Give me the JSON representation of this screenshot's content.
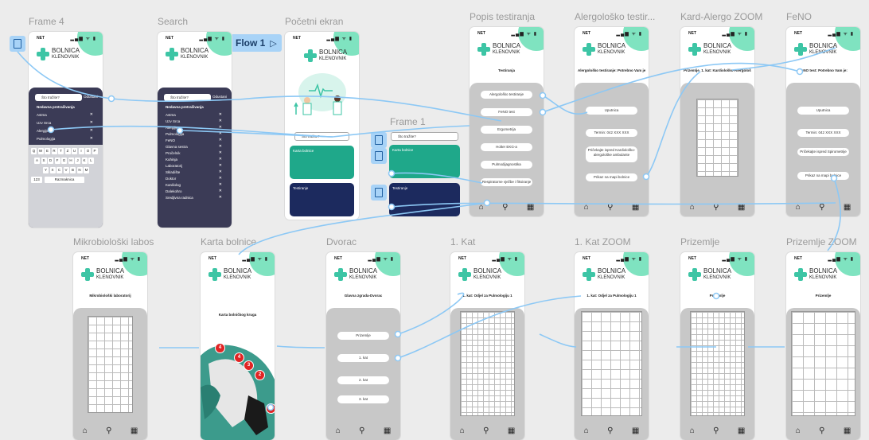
{
  "frame_labels": {
    "frame4": "Frame 4",
    "search": "Search",
    "home": "Početni ekran",
    "frame1": "Frame 1",
    "popis": "Popis testiranja",
    "alergo": "Alergološko testir...",
    "kard_zoom": "Kard-Alergo ZOOM",
    "feno": "FeNO",
    "mikro": "Mikrobiološki labos",
    "karta": "Karta bolnice",
    "dvorac": "Dvorac",
    "kat1": "1. Kat",
    "kat1_zoom": "1. Kat ZOOM",
    "prizemlje": "Prizemlje",
    "prizemlje_zoom": "Prizemlje ZOOM"
  },
  "flow_button": {
    "label": "Flow 1",
    "icon": "play-frame-icon"
  },
  "status": {
    "net": "NET",
    "signal": "▂▄▆ ᯤ ▮"
  },
  "brand": {
    "name": "BOLNICA",
    "sub": "KLENOVNIK",
    "color": "#3dc5a5",
    "accent": "#7fe3c0"
  },
  "search": {
    "placeholder": "Što tražite?",
    "cancel": "Odustani",
    "recent_title": "Nedavna pretraživanja",
    "frame4_items": [
      "Astma",
      "Uzv Srca",
      "Alergije",
      "Pulmologija",
      "FeNO",
      "Glavna sestra"
    ],
    "search_items": [
      "Astma",
      "Uzv Srca",
      "Alergije",
      "Pulmologija",
      "FeNO",
      "Glavna sestra",
      "Pročelnik",
      "Kuhinja",
      "Laboratorij",
      "Skladište",
      "Doktor",
      "Kardiolog",
      "Dalekohro",
      "Sredjivna radnica"
    ]
  },
  "keyboard": {
    "row1": [
      "Q",
      "W",
      "E",
      "R",
      "T",
      "Z",
      "U",
      "I",
      "O",
      "P"
    ],
    "row2": [
      "A",
      "S",
      "D",
      "F",
      "G",
      "H",
      "J",
      "K",
      "L"
    ],
    "row3": [
      "Y",
      "X",
      "C",
      "V",
      "B",
      "N",
      "M"
    ],
    "num": "123",
    "space": "Razmaknica"
  },
  "home": {
    "card1": "Karta bolnice",
    "card2": "Testiranje"
  },
  "popis": {
    "title": "Testiranja",
    "items": [
      "Alergološko testiranje",
      "FeNO test",
      "Ergometrija",
      "Holter EKG-a",
      "Pulmodijagnostika",
      "Respiratorne vježbe i fiksiranje"
    ]
  },
  "alergo": {
    "title": "Alergološko testiranje: Potrebno Vam je:",
    "items": [
      "Uputnica",
      "Termin: 042 XXX XXX",
      "Pričekajte ispred Kardiološko-alergološke ambulante",
      "Prikaz na mapi bolnice"
    ]
  },
  "kard_zoom": {
    "title": "Prizemlje, 1. kat: Kardiološko-Alergološka ambulanta"
  },
  "feno": {
    "title": "FeNO test: Potrebno Vam je:",
    "items": [
      "Uputnica",
      "Termin: 042 XXX XXX",
      "Pričekajte ispred Spirometrije",
      "Prikaz na mapi bolnice"
    ]
  },
  "mikro": {
    "title": "Mikrobiološki laboratorij"
  },
  "karta": {
    "title": "Karta bolničkog kruga",
    "pins": [
      "4",
      "4",
      "3",
      "2",
      "1"
    ]
  },
  "dvorac": {
    "title": "Glavna zgrada-Dvorac",
    "items": [
      "Prizemlje",
      "1. kat",
      "2. kat",
      "3. kat"
    ]
  },
  "kat1": {
    "title": "1. kat: Odjel za Pulmologiju 1"
  },
  "kat1_zoom": {
    "title": "1. kat: Odjel za Pulmologiju 1"
  },
  "prizemlje": {
    "title": "Prizemlje"
  },
  "prizemlje_zoom": {
    "title": "Prizemlje"
  },
  "colors": {
    "canvas": "#ececec",
    "wire": "#8cc8f5",
    "dark": "#3b3b56",
    "teal": "#1fa88a",
    "navy": "#1c2a5e"
  }
}
